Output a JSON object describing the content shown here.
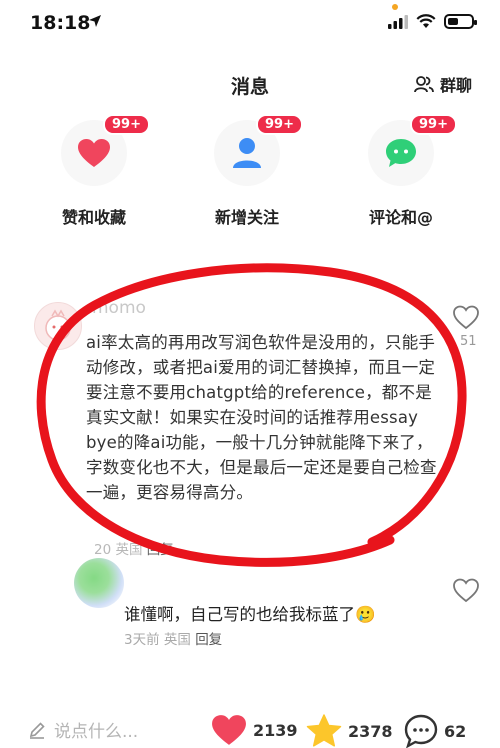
{
  "status_bar": {
    "time": "18:18",
    "location_icon": "navigation-arrow-icon"
  },
  "header": {
    "title": "消息",
    "group_chat_label": "群聊"
  },
  "categories": [
    {
      "label": "赞和收藏",
      "badge": "99+",
      "icon": "heart-icon",
      "color": "#f0455d"
    },
    {
      "label": "新增关注",
      "badge": "99+",
      "icon": "person-icon",
      "color": "#3d8df5"
    },
    {
      "label": "评论和@",
      "badge": "99+",
      "icon": "chat-bubble-icon",
      "color": "#2fcf78"
    }
  ],
  "comment": {
    "username": "momo",
    "text": "ai率太高的再用改写润色软件是没用的，只能手动修改，或者把ai爱用的词汇替换掉，而且一定要注意不要用chatgpt给的reference，都不是真实文献！如果实在没时间的话推荐用essay bye的降ai功能，一般十几分钟就能降下来了，字数变化也不大，但是最后一定还是要自己检查一遍，更容易得高分。",
    "date_fragment": "20",
    "location": "英国",
    "reply_label": "回复",
    "like_count": "51"
  },
  "reply": {
    "text": "谁懂啊，自己写的也给我标蓝了",
    "emoji": "🥲",
    "time": "3天前",
    "location": "英国",
    "reply_label": "回复"
  },
  "bottom_bar": {
    "input_placeholder": "说点什么...",
    "likes": "2139",
    "favorites": "2378",
    "comments": "62"
  },
  "colors": {
    "badge": "#ee2c4a",
    "annotation_circle": "#e8141c"
  }
}
